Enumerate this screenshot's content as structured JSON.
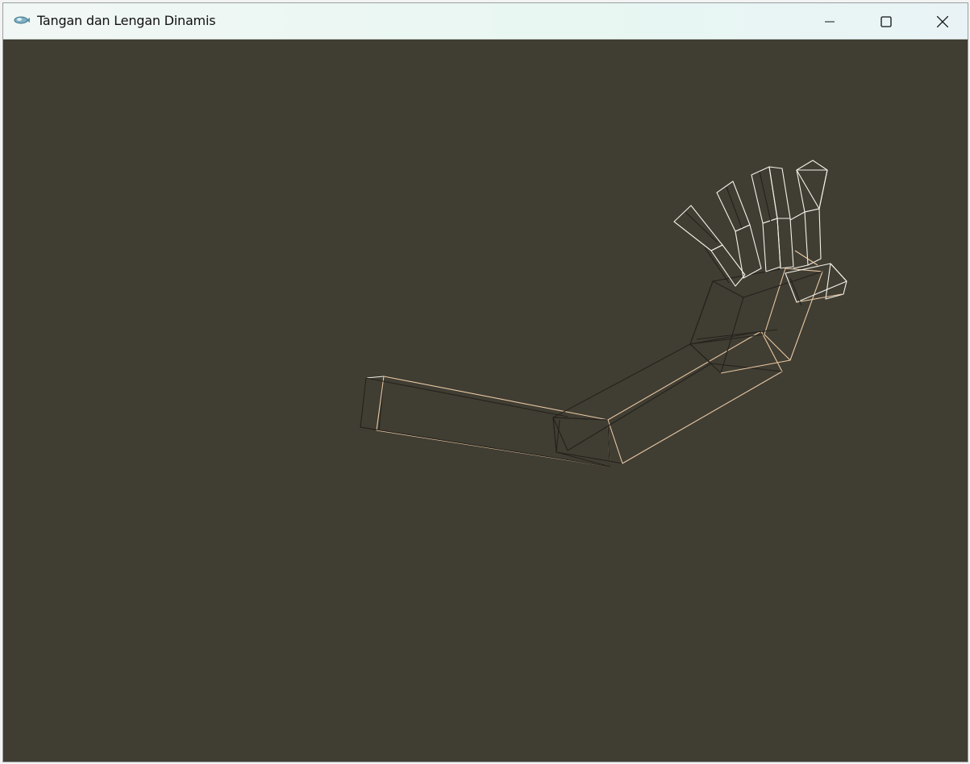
{
  "window": {
    "title": "Tangan dan Lengan Dinamis",
    "app_icon": "opengl-glut-icon"
  },
  "controls": {
    "minimize_icon": "minimize-icon",
    "maximize_icon": "maximize-icon",
    "close_icon": "close-icon"
  },
  "viewport": {
    "background_color": "#403d33",
    "wire_color_lit": "#e8c9a3",
    "wire_color_dark": "#24221c",
    "wire_color_white": "#f4f1ea"
  }
}
